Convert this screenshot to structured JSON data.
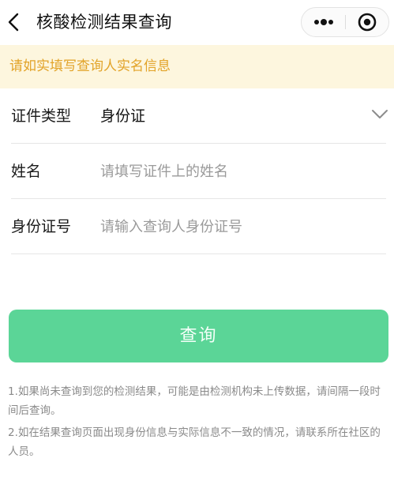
{
  "nav": {
    "back_icon": "chevron-left-icon",
    "title": "核酸检测结果查询",
    "more_icon": "more-dots-icon",
    "close_icon": "target-circle-icon"
  },
  "notice": {
    "text": "请如实填写查询人实名信息",
    "color": "#e2a328",
    "background": "#fdf6de"
  },
  "form": {
    "id_type": {
      "label": "证件类型",
      "value": "身份证",
      "icon": "chevron-down-icon"
    },
    "name": {
      "label": "姓名",
      "placeholder": "请填写证件上的姓名",
      "value": ""
    },
    "id_number": {
      "label": "身份证号",
      "placeholder": "请输入查询人身份证号",
      "value": ""
    }
  },
  "submit": {
    "label": "查询",
    "color": "#5bd597"
  },
  "tips": [
    "1.如果尚未查询到您的检测结果，可能是由检测机构未上传数据，请间隔一段时间后查询。",
    "2.如在结果查询页面出现身份信息与实际信息不一致的情况，请联系所在社区的人员。"
  ]
}
